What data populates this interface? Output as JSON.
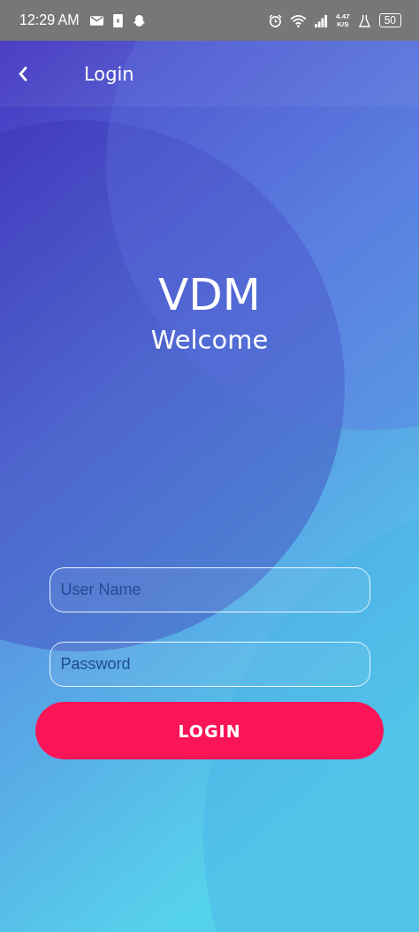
{
  "status_bar": {
    "time": "12:29 AM",
    "net_speed": "4.47",
    "net_speed_unit": "K/S",
    "battery": "50"
  },
  "app_bar": {
    "title": "Login"
  },
  "brand": {
    "title": "VDM",
    "subtitle": "Welcome"
  },
  "username_field": {
    "placeholder": "User Name"
  },
  "password_field": {
    "placeholder": "Password"
  },
  "login_button": {
    "label": "LOGIN"
  }
}
